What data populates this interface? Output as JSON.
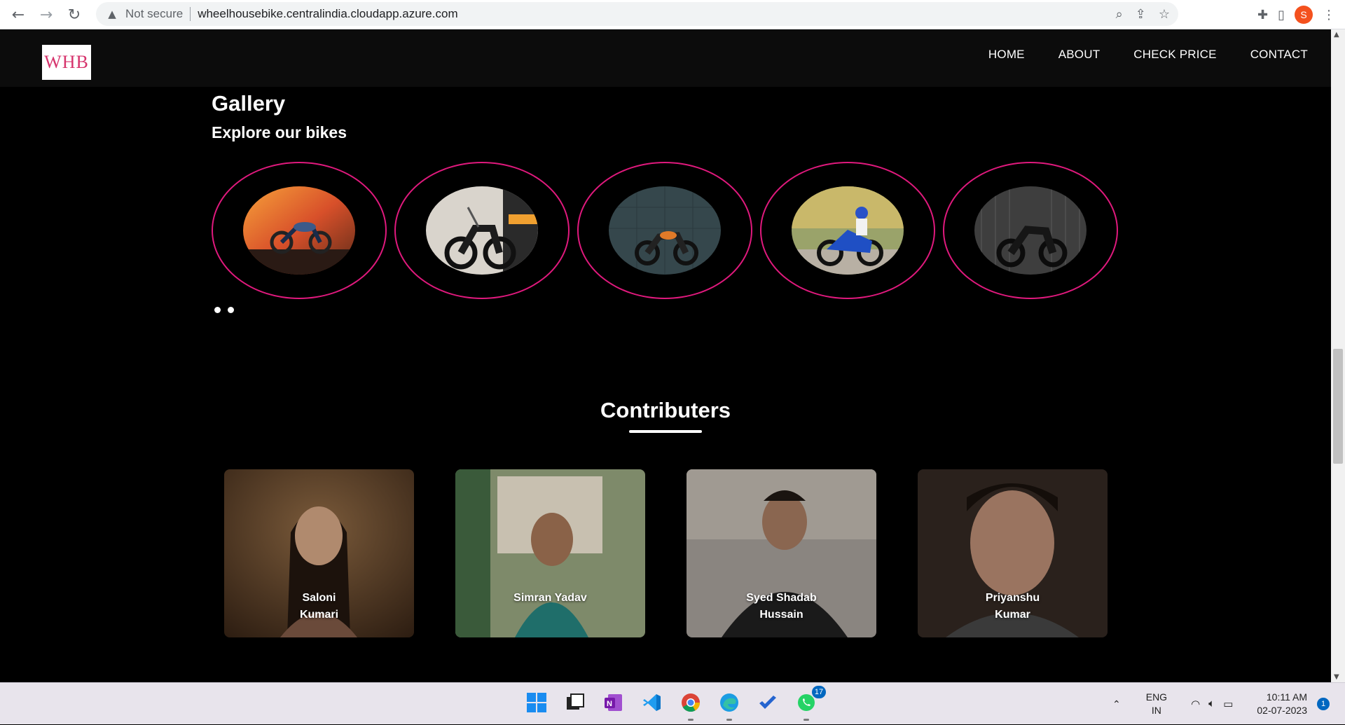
{
  "browser": {
    "security_label": "Not secure",
    "url": "wheelhousebike.centralindia.cloudapp.azure.com",
    "profile_initial": "S"
  },
  "site": {
    "logo_text": "WHB",
    "nav": [
      "HOME",
      "ABOUT",
      "CHECK PRICE",
      "CONTACT"
    ]
  },
  "gallery": {
    "title": "Gallery",
    "subtitle": "Explore our bikes",
    "bikes": [
      "bike-photo-1",
      "bike-photo-2",
      "bike-photo-3",
      "bike-photo-4",
      "bike-photo-5"
    ],
    "carousel_dots": 2
  },
  "contributors": {
    "title": "Contributers",
    "people": [
      {
        "name_line1": "Saloni",
        "name_line2": "Kumari"
      },
      {
        "name_line1": "Simran Yadav",
        "name_line2": ""
      },
      {
        "name_line1": "Syed Shadab",
        "name_line2": "Hussain"
      },
      {
        "name_line1": "Priyanshu",
        "name_line2": "Kumar"
      }
    ]
  },
  "taskbar": {
    "whatsapp_badge": "17",
    "lang_line1": "ENG",
    "lang_line2": "IN",
    "time": "10:11 AM",
    "date": "02-07-2023",
    "notification_count": "1"
  },
  "colors": {
    "accent_ring": "#e0197d",
    "page_bg": "#000000",
    "nav_bg": "#0c0c0c"
  }
}
